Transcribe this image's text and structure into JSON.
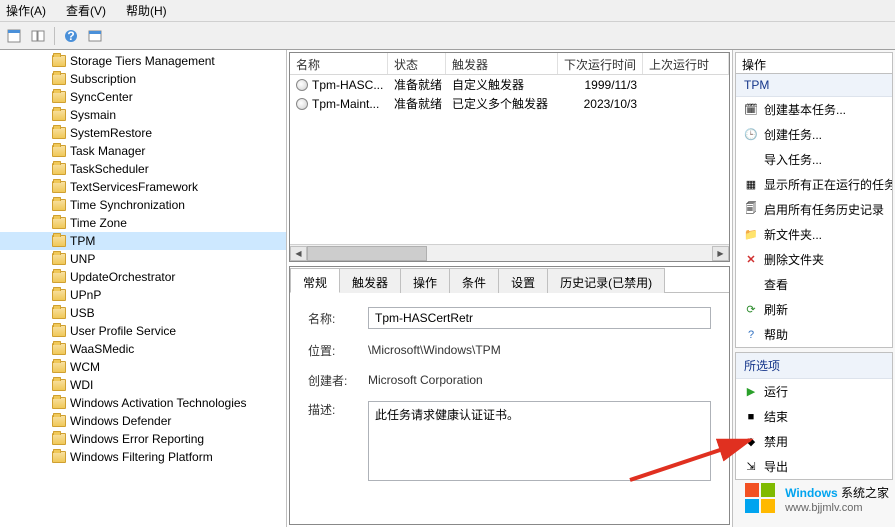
{
  "menu": {
    "action": "操作(A)",
    "view": "查看(V)",
    "help": "帮助(H)"
  },
  "tree": {
    "items": [
      {
        "label": "Storage Tiers Management"
      },
      {
        "label": "Subscription"
      },
      {
        "label": "SyncCenter"
      },
      {
        "label": "Sysmain"
      },
      {
        "label": "SystemRestore"
      },
      {
        "label": "Task Manager"
      },
      {
        "label": "TaskScheduler"
      },
      {
        "label": "TextServicesFramework"
      },
      {
        "label": "Time Synchronization"
      },
      {
        "label": "Time Zone"
      },
      {
        "label": "TPM",
        "selected": true
      },
      {
        "label": "UNP"
      },
      {
        "label": "UpdateOrchestrator"
      },
      {
        "label": "UPnP"
      },
      {
        "label": "USB"
      },
      {
        "label": "User Profile Service"
      },
      {
        "label": "WaaSMedic"
      },
      {
        "label": "WCM"
      },
      {
        "label": "WDI"
      },
      {
        "label": "Windows Activation Technologies"
      },
      {
        "label": "Windows Defender"
      },
      {
        "label": "Windows Error Reporting"
      },
      {
        "label": "Windows Filtering Platform"
      }
    ]
  },
  "list": {
    "columns": {
      "name": "名称",
      "state": "状态",
      "trigger": "触发器",
      "next": "下次运行时间",
      "last": "上次运行时"
    },
    "rows": [
      {
        "name": "Tpm-HASC...",
        "state": "准备就绪",
        "trigger": "自定义触发器",
        "next": "1999/11/3"
      },
      {
        "name": "Tpm-Maint...",
        "state": "准备就绪",
        "trigger": "已定义多个触发器",
        "next": "2023/10/3"
      }
    ]
  },
  "tabs": {
    "general": "常规",
    "triggers": "触发器",
    "action": "操作",
    "conditions": "条件",
    "settings": "设置",
    "history": "历史记录(已禁用)"
  },
  "detail": {
    "name_label": "名称:",
    "name_value": "Tpm-HASCertRetr",
    "location_label": "位置:",
    "location_value": "\\Microsoft\\Windows\\TPM",
    "author_label": "创建者:",
    "author_value": "Microsoft Corporation",
    "desc_label": "描述:",
    "desc_value": "此任务请求健康认证证书。"
  },
  "actions": {
    "header": "操作",
    "section1_title": "TPM",
    "create_basic": "创建基本任务...",
    "create": "创建任务...",
    "import": "导入任务...",
    "show_running": "显示所有正在运行的任务",
    "enable_history": "启用所有任务历史记录",
    "new_folder": "新文件夹...",
    "delete_folder": "删除文件夹",
    "view": "查看",
    "refresh": "刷新",
    "help": "帮助",
    "section2_title": "所选项",
    "run": "运行",
    "end": "结束",
    "disable": "禁用",
    "export": "导出"
  },
  "watermark": {
    "brand": "Windows",
    "suffix": " 系统之家",
    "url": "www.bjjmlv.com"
  },
  "colors": {
    "accent": "#cde8ff",
    "link": "#14358a"
  }
}
